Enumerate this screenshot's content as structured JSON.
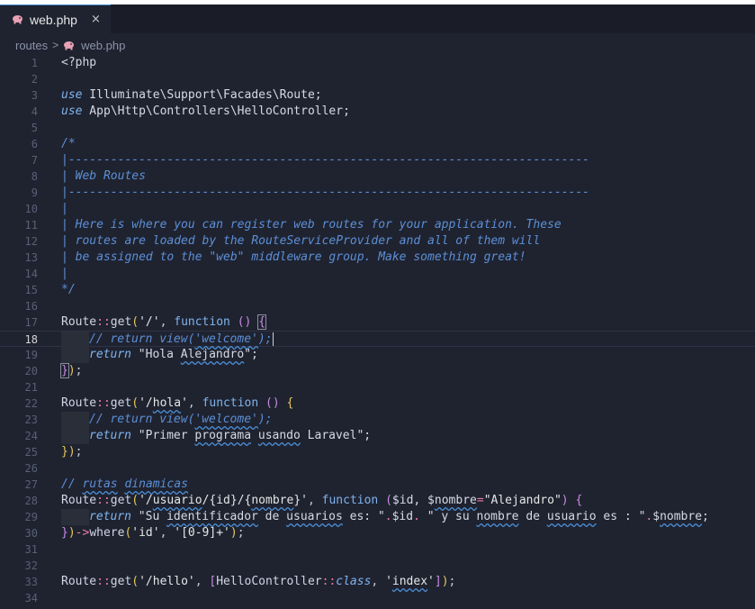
{
  "tab": {
    "label": "web.php",
    "close": "×"
  },
  "breadcrumb": {
    "folder": "routes",
    "separator": ">",
    "file": "web.php"
  },
  "editor": {
    "current_line": 18,
    "lines": [
      {
        "n": "1",
        "tokens": [
          [
            "t-tag",
            "<?php"
          ]
        ]
      },
      {
        "n": "2",
        "tokens": []
      },
      {
        "n": "3",
        "tokens": [
          [
            "t-kw-it",
            "use"
          ],
          [
            "",
            " Illuminate\\Support\\Facades\\Route;"
          ]
        ]
      },
      {
        "n": "4",
        "tokens": [
          [
            "t-kw-it",
            "use"
          ],
          [
            "",
            " App\\Http\\Controllers\\HelloController;"
          ]
        ]
      },
      {
        "n": "5",
        "tokens": []
      },
      {
        "n": "6",
        "tokens": [
          [
            "t-cm",
            "/*"
          ]
        ]
      },
      {
        "n": "7",
        "tokens": [
          [
            "t-cm",
            "|--------------------------------------------------------------------------"
          ]
        ]
      },
      {
        "n": "8",
        "tokens": [
          [
            "t-cm",
            "| Web Routes"
          ]
        ]
      },
      {
        "n": "9",
        "tokens": [
          [
            "t-cm",
            "|--------------------------------------------------------------------------"
          ]
        ]
      },
      {
        "n": "10",
        "tokens": [
          [
            "t-cm",
            "|"
          ]
        ]
      },
      {
        "n": "11",
        "tokens": [
          [
            "t-cm",
            "| Here is where you can register web routes for your application. These"
          ]
        ]
      },
      {
        "n": "12",
        "tokens": [
          [
            "t-cm",
            "| routes are loaded by the RouteServiceProvider and all of them will"
          ]
        ]
      },
      {
        "n": "13",
        "tokens": [
          [
            "t-cm",
            "| be assigned to the \"web\" middleware group. Make something great!"
          ]
        ]
      },
      {
        "n": "14",
        "tokens": [
          [
            "t-cm",
            "|"
          ]
        ]
      },
      {
        "n": "15",
        "tokens": [
          [
            "t-cm",
            "*/"
          ]
        ]
      },
      {
        "n": "16",
        "tokens": []
      },
      {
        "n": "17",
        "tokens": [
          [
            "t-cls",
            "Route"
          ],
          [
            "t-op",
            "::"
          ],
          [
            "t-fn",
            "get"
          ],
          [
            "t-br1",
            "("
          ],
          [
            "t-str",
            "'/'"
          ],
          [
            "t-pun",
            ", "
          ],
          [
            "t-fun",
            "function"
          ],
          [
            "",
            " "
          ],
          [
            "t-br2",
            "()"
          ],
          [
            "",
            " "
          ],
          [
            "t-br2 box",
            "{"
          ]
        ]
      },
      {
        "n": "18",
        "indent": true,
        "tokens": [
          [
            "t-cm",
            "// return view("
          ],
          [
            "t-cm sq",
            "'welcome'"
          ],
          [
            "t-cm",
            ");"
          ],
          [
            "cursor",
            ""
          ]
        ]
      },
      {
        "n": "19",
        "indent": true,
        "tokens": [
          [
            "t-kw-it",
            "return"
          ],
          [
            "",
            " \""
          ],
          [
            "",
            "Hola "
          ],
          [
            "sq",
            "Alejandro"
          ],
          [
            "",
            "\";"
          ]
        ]
      },
      {
        "n": "20",
        "tokens": [
          [
            "t-br2 box",
            "}"
          ],
          [
            "t-br1",
            ")"
          ],
          [
            "t-pun",
            ";"
          ]
        ]
      },
      {
        "n": "21",
        "tokens": []
      },
      {
        "n": "22",
        "tokens": [
          [
            "t-cls",
            "Route"
          ],
          [
            "t-op",
            "::"
          ],
          [
            "t-fn",
            "get"
          ],
          [
            "t-br1",
            "("
          ],
          [
            "t-str",
            "'/"
          ],
          [
            "t-str sq",
            "hola"
          ],
          [
            "t-str",
            "'"
          ],
          [
            "t-pun",
            ", "
          ],
          [
            "t-fun",
            "function"
          ],
          [
            "",
            " "
          ],
          [
            "t-br2",
            "()"
          ],
          [
            "",
            " "
          ],
          [
            "t-br1",
            "{"
          ]
        ]
      },
      {
        "n": "23",
        "indent": true,
        "tokens": [
          [
            "t-cm",
            "// return view("
          ],
          [
            "t-cm sq",
            "'welcome'"
          ],
          [
            "t-cm",
            ");"
          ]
        ]
      },
      {
        "n": "24",
        "indent": true,
        "tokens": [
          [
            "t-kw-it",
            "return"
          ],
          [
            "",
            " \"Primer "
          ],
          [
            "sq",
            "programa"
          ],
          [
            "",
            " "
          ],
          [
            "sq",
            "usando"
          ],
          [
            "",
            " Laravel\";"
          ]
        ]
      },
      {
        "n": "25",
        "tokens": [
          [
            "t-br1",
            "}"
          ],
          [
            "t-br1",
            ")"
          ],
          [
            "t-pun",
            ";"
          ]
        ]
      },
      {
        "n": "26",
        "tokens": []
      },
      {
        "n": "27",
        "tokens": [
          [
            "t-cm",
            "// "
          ],
          [
            "t-cm sq",
            "rutas"
          ],
          [
            "t-cm",
            " "
          ],
          [
            "t-cm sq",
            "dinamicas"
          ]
        ]
      },
      {
        "n": "28",
        "tokens": [
          [
            "t-cls",
            "Route"
          ],
          [
            "t-op",
            "::"
          ],
          [
            "t-fn",
            "get"
          ],
          [
            "t-br1",
            "("
          ],
          [
            "t-str",
            "'/"
          ],
          [
            "t-str sq",
            "usuario"
          ],
          [
            "t-str",
            "/{id}/{"
          ],
          [
            "t-str sq",
            "nombre"
          ],
          [
            "t-str",
            "}'"
          ],
          [
            "t-pun",
            ", "
          ],
          [
            "t-fun",
            "function"
          ],
          [
            "",
            " "
          ],
          [
            "t-br2",
            "("
          ],
          [
            "t-var",
            "$id, $"
          ],
          [
            "t-var sq",
            "nombre"
          ],
          [
            "t-op",
            "="
          ],
          [
            "t-str",
            "\"Alejandro\""
          ],
          [
            "t-br2",
            ")"
          ],
          [
            "",
            " "
          ],
          [
            "t-br2",
            "{"
          ]
        ]
      },
      {
        "n": "29",
        "indent": true,
        "tokens": [
          [
            "t-kw-it",
            "return"
          ],
          [
            "",
            " \"Su "
          ],
          [
            "sq",
            "identificador"
          ],
          [
            "",
            " de "
          ],
          [
            "sq",
            "usuarios"
          ],
          [
            "",
            " es: \""
          ],
          [
            "t-op",
            "."
          ],
          [
            "t-var",
            "$id"
          ],
          [
            "t-op",
            "."
          ],
          [
            "",
            " \" y su "
          ],
          [
            "sq",
            "nombre"
          ],
          [
            "",
            " de "
          ],
          [
            "sq",
            "usuario"
          ],
          [
            "",
            " es : \""
          ],
          [
            "t-op",
            "."
          ],
          [
            "t-var",
            "$"
          ],
          [
            "t-var sq",
            "nombre"
          ],
          [
            "",
            ";"
          ]
        ]
      },
      {
        "n": "30",
        "tokens": [
          [
            "t-br2",
            "}"
          ],
          [
            "t-br1",
            ")"
          ],
          [
            "t-op",
            "->"
          ],
          [
            "t-fn",
            "where"
          ],
          [
            "t-br1",
            "("
          ],
          [
            "t-str",
            "'id'"
          ],
          [
            "t-pun",
            ", "
          ],
          [
            "t-str",
            "'[0-9]+'"
          ],
          [
            "t-br1",
            ")"
          ],
          [
            "t-pun",
            ";"
          ]
        ]
      },
      {
        "n": "31",
        "tokens": []
      },
      {
        "n": "32",
        "tokens": []
      },
      {
        "n": "33",
        "tokens": [
          [
            "t-cls",
            "Route"
          ],
          [
            "t-op",
            "::"
          ],
          [
            "t-fn",
            "get"
          ],
          [
            "t-br1",
            "("
          ],
          [
            "t-str",
            "'/hello'"
          ],
          [
            "t-pun",
            ", "
          ],
          [
            "t-br2",
            "["
          ],
          [
            "t-cls",
            "HelloController"
          ],
          [
            "t-op",
            "::"
          ],
          [
            "t-kw-it",
            "class"
          ],
          [
            "t-pun",
            ", "
          ],
          [
            "t-str",
            "'"
          ],
          [
            "t-str sq",
            "index"
          ],
          [
            "t-str",
            "'"
          ],
          [
            "t-br2",
            "]"
          ],
          [
            "t-br1",
            ")"
          ],
          [
            "t-pun",
            ";"
          ]
        ]
      },
      {
        "n": "34",
        "tokens": []
      }
    ]
  }
}
